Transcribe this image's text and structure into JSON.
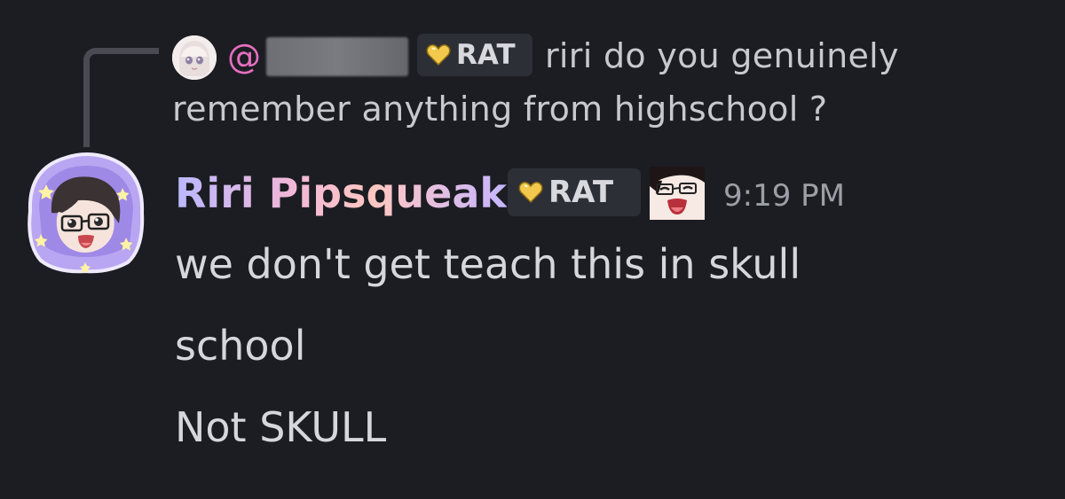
{
  "reply": {
    "mention_prefix": "@",
    "tag_label": "RAT",
    "text_line1": "riri do you genuinely",
    "text_line2": "remember anything from highschool ?"
  },
  "message": {
    "author": "Riri Pipsqueak",
    "tag_label": "RAT",
    "timestamp": "9:19 PM",
    "lines": [
      "we don't get teach this in skull",
      "school",
      "Not SKULL"
    ]
  },
  "colors": {
    "background": "#1c1d22",
    "mention": "#e66fbf",
    "tag_bg": "#2d2f36",
    "text": "#d5d7dc",
    "timestamp": "#9c9fa6",
    "heart": "#f2c94c"
  },
  "icons": {
    "tag_icon": "gold-heart-icon",
    "reply_avatar": "avatar",
    "author_avatar": "avatar",
    "author_emoji": "glasses-face-emoji-icon"
  }
}
